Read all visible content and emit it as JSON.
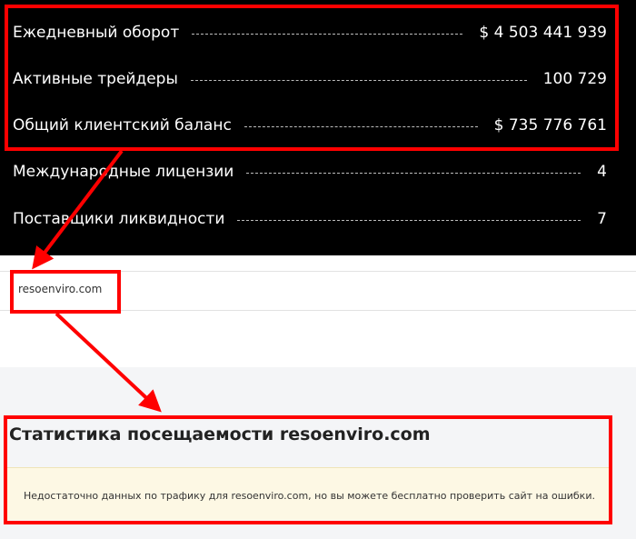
{
  "stats": {
    "rows": [
      {
        "label": "Ежедневный оборот",
        "value": "$ 4 503 441 939"
      },
      {
        "label": "Активные трейдеры",
        "value": "100 729"
      },
      {
        "label": "Общий клиентский баланс",
        "value": "$ 735 776 761"
      },
      {
        "label": "Международные лицензии",
        "value": "4"
      },
      {
        "label": "Поставщики ликвидности",
        "value": "7"
      }
    ]
  },
  "url_strip": {
    "text": "resoenviro.com"
  },
  "traffic_card": {
    "title": "Статистика посещаемости resoenviro.com",
    "notice": "Недостаточно данных по трафику для resoenviro.com, но вы можете бесплатно проверить сайт на ошибки."
  },
  "colors": {
    "annotation": "#ff0000",
    "panel_bg": "#000000",
    "notice_bg": "#fdf8e4"
  }
}
